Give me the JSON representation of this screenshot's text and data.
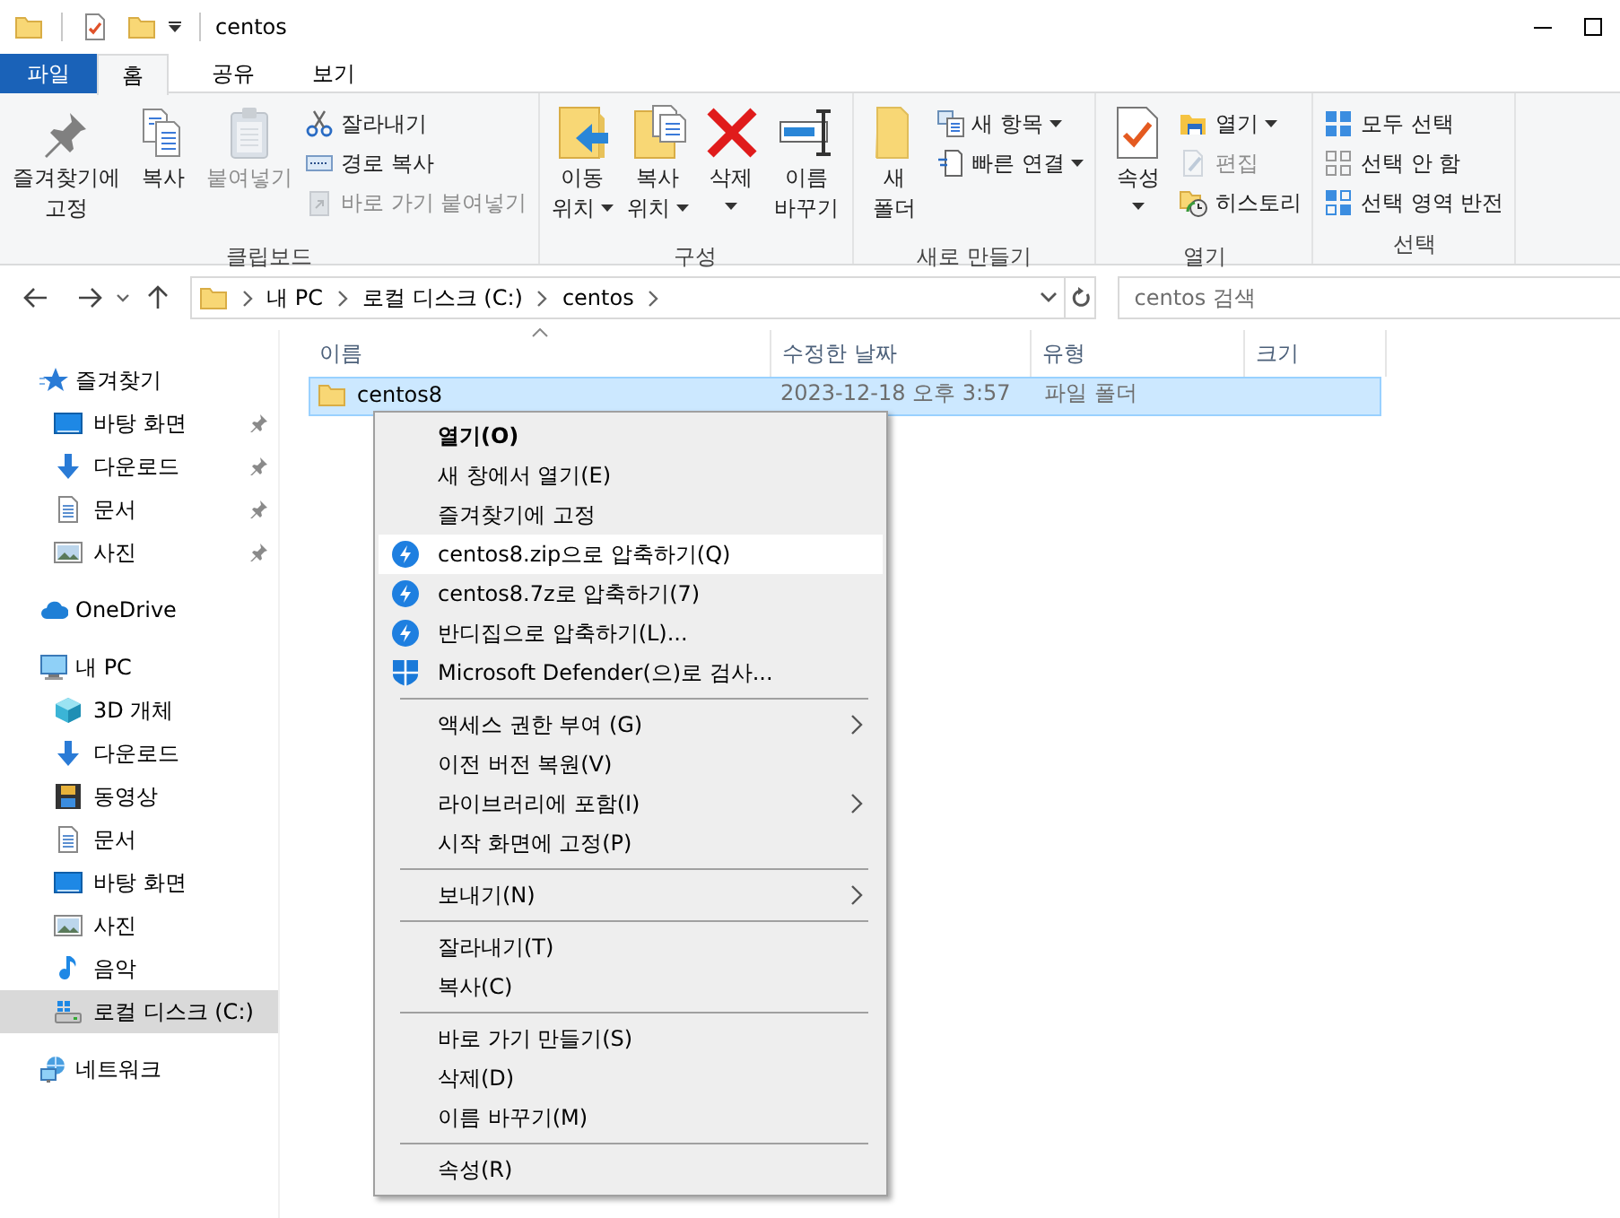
{
  "window": {
    "title": "centos"
  },
  "ribbon_tabs": [
    {
      "label": "파일",
      "kind": "file",
      "selected": false
    },
    {
      "label": "홈",
      "kind": "tab",
      "selected": true
    },
    {
      "label": "공유",
      "kind": "tab",
      "selected": false
    },
    {
      "label": "보기",
      "kind": "tab",
      "selected": false
    }
  ],
  "ribbon_groups": [
    {
      "label": "클립보드",
      "large": [
        {
          "label": "즐겨찾기에\n고정",
          "disabled": false,
          "dropdown": false
        },
        {
          "label": "복사",
          "disabled": false,
          "dropdown": false
        },
        {
          "label": "붙여넣기",
          "disabled": true,
          "dropdown": false
        }
      ],
      "small": [
        {
          "label": "잘라내기",
          "disabled": false,
          "dropdown": false
        },
        {
          "label": "경로 복사",
          "disabled": false,
          "dropdown": false
        },
        {
          "label": "바로 가기 붙여넣기",
          "disabled": true,
          "dropdown": false
        }
      ]
    },
    {
      "label": "구성",
      "large": [
        {
          "label": "이동\n위치",
          "disabled": false,
          "dropdown": true
        },
        {
          "label": "복사\n위치",
          "disabled": false,
          "dropdown": true
        },
        {
          "label": "삭제",
          "disabled": false,
          "dropdown": true
        },
        {
          "label": "이름\n바꾸기",
          "disabled": false,
          "dropdown": false
        }
      ]
    },
    {
      "label": "새로 만들기",
      "large": [
        {
          "label": "새\n폴더",
          "disabled": false,
          "dropdown": false
        }
      ],
      "small": [
        {
          "label": "새 항목",
          "disabled": false,
          "dropdown": true
        },
        {
          "label": "빠른 연결",
          "disabled": false,
          "dropdown": true
        }
      ]
    },
    {
      "label": "열기",
      "large": [
        {
          "label": "속성",
          "disabled": false,
          "dropdown": true
        }
      ],
      "small": [
        {
          "label": "열기",
          "disabled": false,
          "dropdown": true
        },
        {
          "label": "편집",
          "disabled": true,
          "dropdown": false
        },
        {
          "label": "히스토리",
          "disabled": false,
          "dropdown": false
        }
      ]
    },
    {
      "label": "선택",
      "small": [
        {
          "label": "모두 선택",
          "disabled": false,
          "dropdown": false
        },
        {
          "label": "선택 안 함",
          "disabled": false,
          "dropdown": false
        },
        {
          "label": "선택 영역 반전",
          "disabled": false,
          "dropdown": false
        }
      ]
    }
  ],
  "address_bar": {
    "crumbs": [
      "내 PC",
      "로컬 디스크 (C:)",
      "centos"
    ]
  },
  "search": {
    "placeholder": "centos 검색"
  },
  "navigation": [
    {
      "label": "즐겨찾기",
      "selected": false,
      "children": [
        {
          "label": "바탕 화면",
          "pinned": true,
          "selected": false
        },
        {
          "label": "다운로드",
          "pinned": true,
          "selected": false
        },
        {
          "label": "문서",
          "pinned": true,
          "selected": false
        },
        {
          "label": "사진",
          "pinned": true,
          "selected": false
        }
      ]
    },
    {
      "label": "OneDrive",
      "selected": false
    },
    {
      "label": "내 PC",
      "selected": false,
      "children": [
        {
          "label": "3D 개체",
          "pinned": false,
          "selected": false
        },
        {
          "label": "다운로드",
          "pinned": false,
          "selected": false
        },
        {
          "label": "동영상",
          "pinned": false,
          "selected": false
        },
        {
          "label": "문서",
          "pinned": false,
          "selected": false
        },
        {
          "label": "바탕 화면",
          "pinned": false,
          "selected": false
        },
        {
          "label": "사진",
          "pinned": false,
          "selected": false
        },
        {
          "label": "음악",
          "pinned": false,
          "selected": false
        },
        {
          "label": "로컬 디스크 (C:)",
          "pinned": false,
          "selected": true
        }
      ]
    },
    {
      "label": "네트워크",
      "selected": false
    }
  ],
  "columns": [
    {
      "label": "이름",
      "sorted": true
    },
    {
      "label": "수정한 날짜",
      "sorted": false
    },
    {
      "label": "유형",
      "sorted": false
    },
    {
      "label": "크기",
      "sorted": false
    }
  ],
  "rows": [
    {
      "name": "centos8",
      "modified": "2023-12-18 오후 3:57",
      "type": "파일 폴더",
      "selected": true
    }
  ],
  "context_menu": {
    "sections": [
      {
        "items": [
          {
            "label": "열기(O)",
            "default": true,
            "hovered": false,
            "submenu": false
          },
          {
            "label": "새 창에서 열기(E)",
            "default": false,
            "hovered": false,
            "submenu": false
          },
          {
            "label": "즐겨찾기에 고정",
            "default": false,
            "hovered": false,
            "submenu": false
          },
          {
            "label": "centos8.zip으로 압축하기(Q)",
            "default": false,
            "hovered": true,
            "submenu": false
          },
          {
            "label": "centos8.7z로 압축하기(7)",
            "default": false,
            "hovered": false,
            "submenu": false
          },
          {
            "label": "반디집으로 압축하기(L)...",
            "default": false,
            "hovered": false,
            "submenu": false
          },
          {
            "label": "Microsoft Defender(으)로 검사...",
            "default": false,
            "hovered": false,
            "submenu": false
          }
        ]
      },
      {
        "items": [
          {
            "label": "액세스 권한 부여 (G)",
            "default": false,
            "hovered": false,
            "submenu": true
          },
          {
            "label": "이전 버전 복원(V)",
            "default": false,
            "hovered": false,
            "submenu": false
          },
          {
            "label": "라이브러리에 포함(I)",
            "default": false,
            "hovered": false,
            "submenu": true
          },
          {
            "label": "시작 화면에 고정(P)",
            "default": false,
            "hovered": false,
            "submenu": false
          }
        ]
      },
      {
        "items": [
          {
            "label": "보내기(N)",
            "default": false,
            "hovered": false,
            "submenu": true
          }
        ]
      },
      {
        "items": [
          {
            "label": "잘라내기(T)",
            "default": false,
            "hovered": false,
            "submenu": false
          },
          {
            "label": "복사(C)",
            "default": false,
            "hovered": false,
            "submenu": false
          }
        ]
      },
      {
        "items": [
          {
            "label": "바로 가기 만들기(S)",
            "default": false,
            "hovered": false,
            "submenu": false
          },
          {
            "label": "삭제(D)",
            "default": false,
            "hovered": false,
            "submenu": false
          },
          {
            "label": "이름 바꾸기(M)",
            "default": false,
            "hovered": false,
            "submenu": false
          }
        ]
      },
      {
        "items": [
          {
            "label": "속성(R)",
            "default": false,
            "hovered": false,
            "submenu": false
          }
        ]
      }
    ]
  }
}
